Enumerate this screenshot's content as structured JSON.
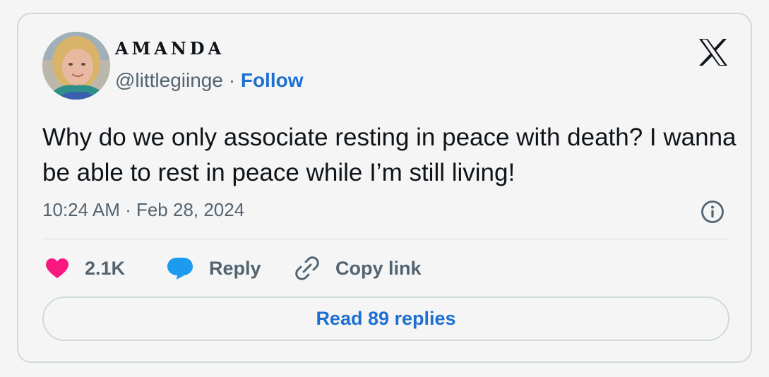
{
  "author": {
    "display_name": "AMANDA",
    "handle": "@littlegiinge",
    "separator": "·",
    "follow_label": "Follow"
  },
  "tweet": {
    "text": "Why do we only associate resting in peace with death? I wanna be able to rest in peace while I’m still living!",
    "timestamp": "10:24 AM · Feb 28, 2024"
  },
  "actions": {
    "like_count": "2.1K",
    "reply_label": "Reply",
    "copy_link_label": "Copy link"
  },
  "read_replies_label": "Read 89 replies",
  "colors": {
    "like": "#f91880",
    "reply": "#1d9bf0",
    "link": "#1d6fd1",
    "muted": "#536471",
    "text": "#0f1419",
    "border": "#cfd9de"
  },
  "icons": {
    "brand": "x-logo-icon",
    "info": "info-icon",
    "like": "heart-icon",
    "reply": "speech-bubble-icon",
    "copy": "link-icon"
  }
}
